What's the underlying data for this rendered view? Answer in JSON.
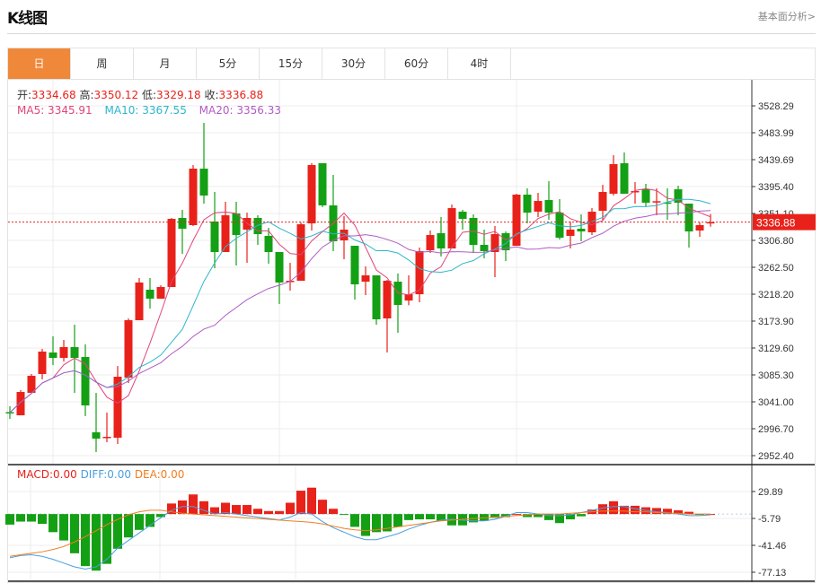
{
  "header": {
    "title": "K线图",
    "link": "基本面分析>"
  },
  "tabs": [
    {
      "label": "日",
      "active": true
    },
    {
      "label": "周"
    },
    {
      "label": "月"
    },
    {
      "label": "5分"
    },
    {
      "label": "15分"
    },
    {
      "label": "30分"
    },
    {
      "label": "60分"
    },
    {
      "label": "4时"
    }
  ],
  "info": {
    "open_label": "开:",
    "open": "3334.68",
    "high_label": "高:",
    "high": "3350.12",
    "low_label": "低:",
    "low": "3329.18",
    "close_label": "收:",
    "close": "3336.88",
    "ma5": "MA5: 3345.91",
    "ma10": "MA10: 3367.55",
    "ma20": "MA20: 3356.33",
    "macd": "MACD:0.00",
    "diff": "DIFF:0.00",
    "dea": "DEA:0.00"
  },
  "colors": {
    "up": "#e8221a",
    "down": "#14a014",
    "ma5": "#e0457b",
    "ma10": "#2cb7c9",
    "ma20": "#b05cc4",
    "diff": "#4a9fe0",
    "dea": "#f07e22",
    "active_tab": "#f0883a"
  },
  "chart_data": [
    {
      "type": "candlestick",
      "current_price": "3336.88",
      "yticks": [
        "3528.29",
        "3483.99",
        "3439.69",
        "3395.40",
        "3351.10",
        "3306.80",
        "3262.50",
        "3218.20",
        "3173.90",
        "3129.60",
        "3085.30",
        "3041.00",
        "2996.70",
        "2952.40"
      ],
      "ylim": [
        2952.4,
        3528.29
      ],
      "series_ma": [
        "MA5",
        "MA10",
        "MA20"
      ],
      "ohlc": [
        [
          3024.0,
          3023.3,
          3033.6,
          3012.9
        ],
        [
          3018.8,
          3057.2,
          3060.2,
          3018.8
        ],
        [
          3055.8,
          3083.8,
          3086.8,
          3055.8
        ],
        [
          3086.8,
          3123.7,
          3128.1,
          3077.9
        ],
        [
          3122.2,
          3113.3,
          3148.8,
          3101.5
        ],
        [
          3113.3,
          3131.1,
          3142.9,
          3107.4
        ],
        [
          3131.1,
          3113.3,
          3168.0,
          3055.8
        ],
        [
          3114.8,
          3035.1,
          3135.5,
          3017.4
        ],
        [
          2990.8,
          2980.4,
          3055.8,
          2958.3
        ],
        [
          2981.9,
          2983.4,
          3023.3,
          2974.5
        ],
        [
          2981.9,
          3082.3,
          3100.0,
          2971.6
        ],
        [
          3080.9,
          3175.4,
          3178.3,
          3072.0
        ],
        [
          3175.4,
          3237.4,
          3244.8,
          3175.4
        ],
        [
          3225.6,
          3210.8,
          3244.8,
          3194.5
        ],
        [
          3210.8,
          3230.0,
          3232.9,
          3210.8
        ],
        [
          3230.0,
          3342.2,
          3343.7,
          3230.0
        ],
        [
          3343.7,
          3326.0,
          3357.0,
          3284.6
        ],
        [
          3331.9,
          3424.9,
          3430.8,
          3330.4
        ],
        [
          3424.9,
          3380.6,
          3500.2,
          3367.3
        ],
        [
          3337.8,
          3287.6,
          3386.5,
          3261.0
        ],
        [
          3287.6,
          3348.1,
          3370.3,
          3287.6
        ],
        [
          3351.1,
          3315.6,
          3370.3,
          3265.4
        ],
        [
          3324.5,
          3343.7,
          3352.5,
          3269.9
        ],
        [
          3343.7,
          3317.1,
          3348.1,
          3299.4
        ],
        [
          3314.2,
          3287.6,
          3327.4,
          3268.4
        ],
        [
          3287.6,
          3237.4,
          3287.6,
          3201.9
        ],
        [
          3239.8,
          3240.3,
          3269.9,
          3224.1
        ],
        [
          3240.3,
          3333.3,
          3336.3,
          3240.3
        ],
        [
          3334.8,
          3430.8,
          3433.8,
          3323.0
        ],
        [
          3433.8,
          3364.4,
          3433.8,
          3361.4
        ],
        [
          3364.4,
          3305.3,
          3414.6,
          3289.1
        ],
        [
          3306.8,
          3324.5,
          3346.6,
          3275.8
        ],
        [
          3297.9,
          3234.4,
          3297.9,
          3209.3
        ],
        [
          3238.8,
          3249.2,
          3263.9,
          3216.7
        ],
        [
          3249.2,
          3176.8,
          3249.2,
          3168.0
        ],
        [
          3178.3,
          3240.3,
          3241.8,
          3122.2
        ],
        [
          3238.8,
          3200.5,
          3252.1,
          3154.7
        ],
        [
          3207.8,
          3218.2,
          3249.2,
          3200.0
        ],
        [
          3218.2,
          3289.1,
          3295.0,
          3204.9
        ],
        [
          3290.5,
          3315.6,
          3323.0,
          3286.1
        ],
        [
          3318.6,
          3293.5,
          3345.2,
          3280.2
        ],
        [
          3293.5,
          3359.9,
          3365.8,
          3293.5
        ],
        [
          3354.0,
          3342.2,
          3357.0,
          3324.5
        ],
        [
          3343.7,
          3299.4,
          3349.6,
          3286.1
        ],
        [
          3299.4,
          3289.1,
          3324.5,
          3277.2
        ],
        [
          3287.6,
          3317.1,
          3330.4,
          3246.2
        ],
        [
          3318.6,
          3290.5,
          3321.5,
          3272.8
        ],
        [
          3297.9,
          3382.1,
          3383.6,
          3297.9
        ],
        [
          3382.1,
          3352.5,
          3392.4,
          3334.8
        ],
        [
          3354.0,
          3371.7,
          3385.0,
          3345.2
        ],
        [
          3373.2,
          3352.5,
          3404.2,
          3340.7
        ],
        [
          3352.5,
          3311.2,
          3374.7,
          3308.2
        ],
        [
          3314.2,
          3324.5,
          3337.8,
          3293.5
        ],
        [
          3326.0,
          3321.5,
          3349.6,
          3305.3
        ],
        [
          3320.1,
          3354.0,
          3359.9,
          3315.6
        ],
        [
          3355.5,
          3386.5,
          3398.3,
          3339.3
        ],
        [
          3383.6,
          3432.3,
          3447.0,
          3380.6
        ],
        [
          3433.8,
          3383.6,
          3451.5,
          3383.6
        ],
        [
          3386.5,
          3388.0,
          3402.7,
          3367.3
        ],
        [
          3390.9,
          3368.8,
          3399.8,
          3362.9
        ],
        [
          3370.3,
          3371.3,
          3392.4,
          3348.1
        ],
        [
          3369.3,
          3368.8,
          3392.4,
          3340.7
        ],
        [
          3390.9,
          3368.8,
          3396.8,
          3348.1
        ],
        [
          3367.3,
          3321.5,
          3367.3,
          3295.0
        ],
        [
          3323.0,
          3331.9,
          3336.3,
          3312.7
        ],
        [
          3334.68,
          3336.88,
          3350.12,
          3329.18
        ]
      ]
    },
    {
      "type": "bar+line",
      "yticks": [
        "29.89",
        "-5.79",
        "-41.46",
        "-77.13"
      ],
      "ylim": [
        -77.13,
        29.89
      ],
      "macd": [
        -14,
        -10,
        -10,
        -13,
        -24,
        -35,
        -52,
        -69,
        -75,
        -66,
        -46,
        -31,
        -21,
        -17,
        -4,
        14,
        18,
        26,
        17,
        9,
        15,
        12,
        12,
        7,
        4,
        4,
        15,
        31,
        35,
        19,
        7,
        -1,
        -17,
        -29,
        -24,
        -23,
        -17,
        -8,
        -7,
        -7,
        -9,
        -15,
        -15,
        -11,
        -9,
        -5,
        -4,
        0,
        -4,
        -4,
        -8,
        -12,
        -7,
        -3,
        6,
        13,
        17,
        11,
        11,
        9,
        8,
        7,
        5,
        3,
        -1,
        0
      ],
      "diff": [
        -58,
        -55,
        -54,
        -56,
        -60,
        -65,
        -70,
        -73,
        -70,
        -60,
        -45,
        -35,
        -25,
        -15,
        -5,
        5,
        10,
        10,
        5,
        0,
        2,
        0,
        -2,
        -4,
        -6,
        -8,
        -4,
        2,
        0,
        -10,
        -18,
        -24,
        -30,
        -34,
        -34,
        -30,
        -26,
        -20,
        -15,
        -11,
        -8,
        -7,
        -8,
        -9,
        -9,
        -7,
        -3,
        2,
        2,
        0,
        -2,
        -2,
        -1,
        2,
        5,
        8,
        10,
        10,
        7,
        5,
        3,
        2,
        0,
        -2,
        -2,
        -1
      ],
      "dea": [
        -56,
        -54,
        -52,
        -50,
        -47,
        -43,
        -37,
        -30,
        -22,
        -14,
        -7,
        -1,
        3,
        5,
        5,
        3,
        1,
        0,
        -1,
        -2,
        -3,
        -4,
        -5,
        -6,
        -7,
        -8,
        -9,
        -10,
        -11,
        -13,
        -16,
        -19,
        -21,
        -22,
        -21,
        -19,
        -17,
        -15,
        -13,
        -11,
        -9,
        -8,
        -7,
        -6,
        -5,
        -4,
        -3,
        -2,
        -1,
        0,
        0,
        0,
        1,
        2,
        3,
        4,
        4,
        4,
        3,
        3,
        2,
        1,
        1,
        0,
        0,
        0
      ]
    }
  ]
}
